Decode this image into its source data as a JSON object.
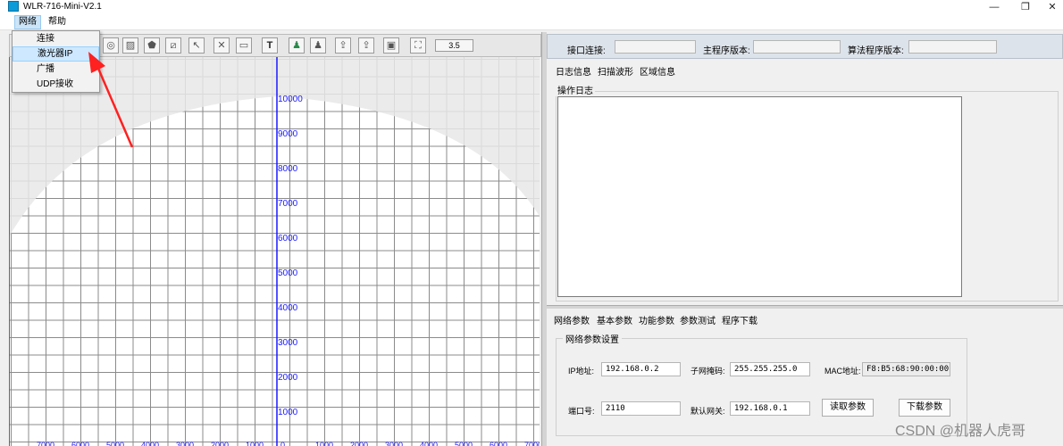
{
  "window": {
    "title": "WLR-716-Mini-V2.1",
    "controls": {
      "minimize": "—",
      "restore": "❐",
      "close": "✕"
    }
  },
  "menubar": {
    "items": [
      "网络",
      "帮助"
    ]
  },
  "dropdown": {
    "items": [
      "连接",
      "激光器IP",
      "广播",
      "UDP接收"
    ],
    "highlighted": "激光器IP"
  },
  "toolbar": {
    "zoom_value": "3.5"
  },
  "plot": {
    "y_labels": [
      "10000",
      "9000",
      "8000",
      "7000",
      "6000",
      "5000",
      "4000",
      "3000",
      "2000",
      "1000"
    ],
    "x_labels": [
      "7000",
      "6000",
      "5000",
      "4000",
      "3000",
      "2000",
      "1000",
      "0",
      "1000",
      "2000",
      "3000",
      "4000",
      "5000",
      "6000",
      "7000"
    ]
  },
  "infobar": {
    "port_label": "接口连接:",
    "main_version_label": "主程序版本:",
    "algo_version_label": "算法程序版本:",
    "port_value": "",
    "main_version_value": "",
    "algo_version_value": ""
  },
  "top_tabs": [
    "日志信息",
    "扫描波形",
    "区域信息"
  ],
  "log": {
    "title": "操作日志",
    "content": ""
  },
  "bottom_tabs": [
    "网络参数",
    "基本参数",
    "功能参数",
    "参数测试",
    "程序下载"
  ],
  "network": {
    "title": "网络参数设置",
    "ip_label": "IP地址:",
    "ip_value": "192.168.0.2",
    "mask_label": "子网掩码:",
    "mask_value": "255.255.255.0",
    "mac_label": "MAC地址:",
    "mac_value": "F8:B5:68:90:00:00",
    "port_label": "端口号:",
    "port_value": "2110",
    "gateway_label": "默认网关:",
    "gateway_value": "192.168.0.1",
    "read_button": "读取参数",
    "download_button": "下载参数"
  },
  "watermark": "CSDN @机器人虎哥",
  "colors": {
    "accent": "#0a9bd8",
    "axis": "#1a1aff",
    "arrow": "#ff2020"
  }
}
